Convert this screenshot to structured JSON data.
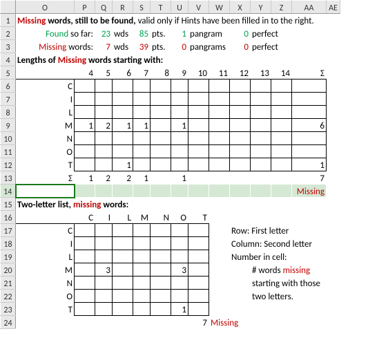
{
  "cols": [
    "",
    "O",
    "P",
    "Q",
    "R",
    "S",
    "T",
    "U",
    "V",
    "W",
    "X",
    "Y",
    "Z",
    "AA",
    "AE"
  ],
  "r1": {
    "a": "Missing",
    "b": " words, still to be found, ",
    "c": "valid only if Hints have been filled in to the right."
  },
  "r2": {
    "a": "Found",
    "b": " so far:",
    "c": "23",
    "d": "wds",
    "e": "85",
    "f": "pts.",
    "g": "1",
    "h": "pangram",
    "i": "0",
    "j": "perfect"
  },
  "r3": {
    "a": "Missing",
    "b": " words:",
    "c": "7",
    "d": "wds",
    "e": "39",
    "f": "pts.",
    "g": "0",
    "h": "pangrams",
    "i": "0",
    "j": "perfect"
  },
  "r4": {
    "a": "Lengths of ",
    "b": "Missing",
    "c": " words starting with:"
  },
  "lenH": [
    "4",
    "5",
    "6",
    "7",
    "8",
    "9",
    "10",
    "11",
    "12",
    "13",
    "14",
    "Σ"
  ],
  "lrows": [
    "C",
    "I",
    "L",
    "M",
    "N",
    "O",
    "T",
    "Σ"
  ],
  "ld": {
    "M": {
      "4": "1",
      "5": "2",
      "6": "1",
      "7": "1",
      "9": "1",
      "Σ": "6"
    },
    "T": {
      "6": "1",
      "Σ": "1"
    },
    "Σ": {
      "4": "1",
      "5": "2",
      "6": "2",
      "7": "1",
      "9": "1",
      "Σ": "7"
    }
  },
  "miss": "Missing",
  "r15": {
    "a": "Two-letter list, ",
    "b": "missing",
    "c": " words:"
  },
  "tcols": [
    "C",
    "I",
    "L",
    "M",
    "N",
    "O",
    "T"
  ],
  "trows": [
    "C",
    "I",
    "L",
    "M",
    "N",
    "O",
    "T"
  ],
  "td": {
    "M": {
      "I": "3",
      "O": "3"
    },
    "T": {
      "O": "1"
    }
  },
  "notes": {
    "row": "Row:  First letter",
    "col": "Column:  Second letter",
    "num": "Number in cell:",
    "wm": "# words ",
    "mi": "missing",
    "sw": "starting with those",
    "tl": "two letters."
  },
  "tot": "7",
  "miss2": "Missing",
  "chart_data": {
    "type": "table",
    "title": "Missing word lengths by starting letter",
    "categories": [
      "4",
      "5",
      "6",
      "7",
      "8",
      "9",
      "10",
      "11",
      "12",
      "13",
      "14",
      "Σ"
    ],
    "series": [
      {
        "name": "C",
        "values": [
          0,
          0,
          0,
          0,
          0,
          0,
          0,
          0,
          0,
          0,
          0,
          0
        ]
      },
      {
        "name": "I",
        "values": [
          0,
          0,
          0,
          0,
          0,
          0,
          0,
          0,
          0,
          0,
          0,
          0
        ]
      },
      {
        "name": "L",
        "values": [
          0,
          0,
          0,
          0,
          0,
          0,
          0,
          0,
          0,
          0,
          0,
          0
        ]
      },
      {
        "name": "M",
        "values": [
          1,
          2,
          1,
          1,
          0,
          1,
          0,
          0,
          0,
          0,
          0,
          6
        ]
      },
      {
        "name": "N",
        "values": [
          0,
          0,
          0,
          0,
          0,
          0,
          0,
          0,
          0,
          0,
          0,
          0
        ]
      },
      {
        "name": "O",
        "values": [
          0,
          0,
          0,
          0,
          0,
          0,
          0,
          0,
          0,
          0,
          0,
          0
        ]
      },
      {
        "name": "T",
        "values": [
          0,
          0,
          1,
          0,
          0,
          0,
          0,
          0,
          0,
          0,
          0,
          1
        ]
      },
      {
        "name": "Σ",
        "values": [
          1,
          2,
          2,
          1,
          0,
          1,
          0,
          0,
          0,
          0,
          0,
          7
        ]
      }
    ]
  }
}
